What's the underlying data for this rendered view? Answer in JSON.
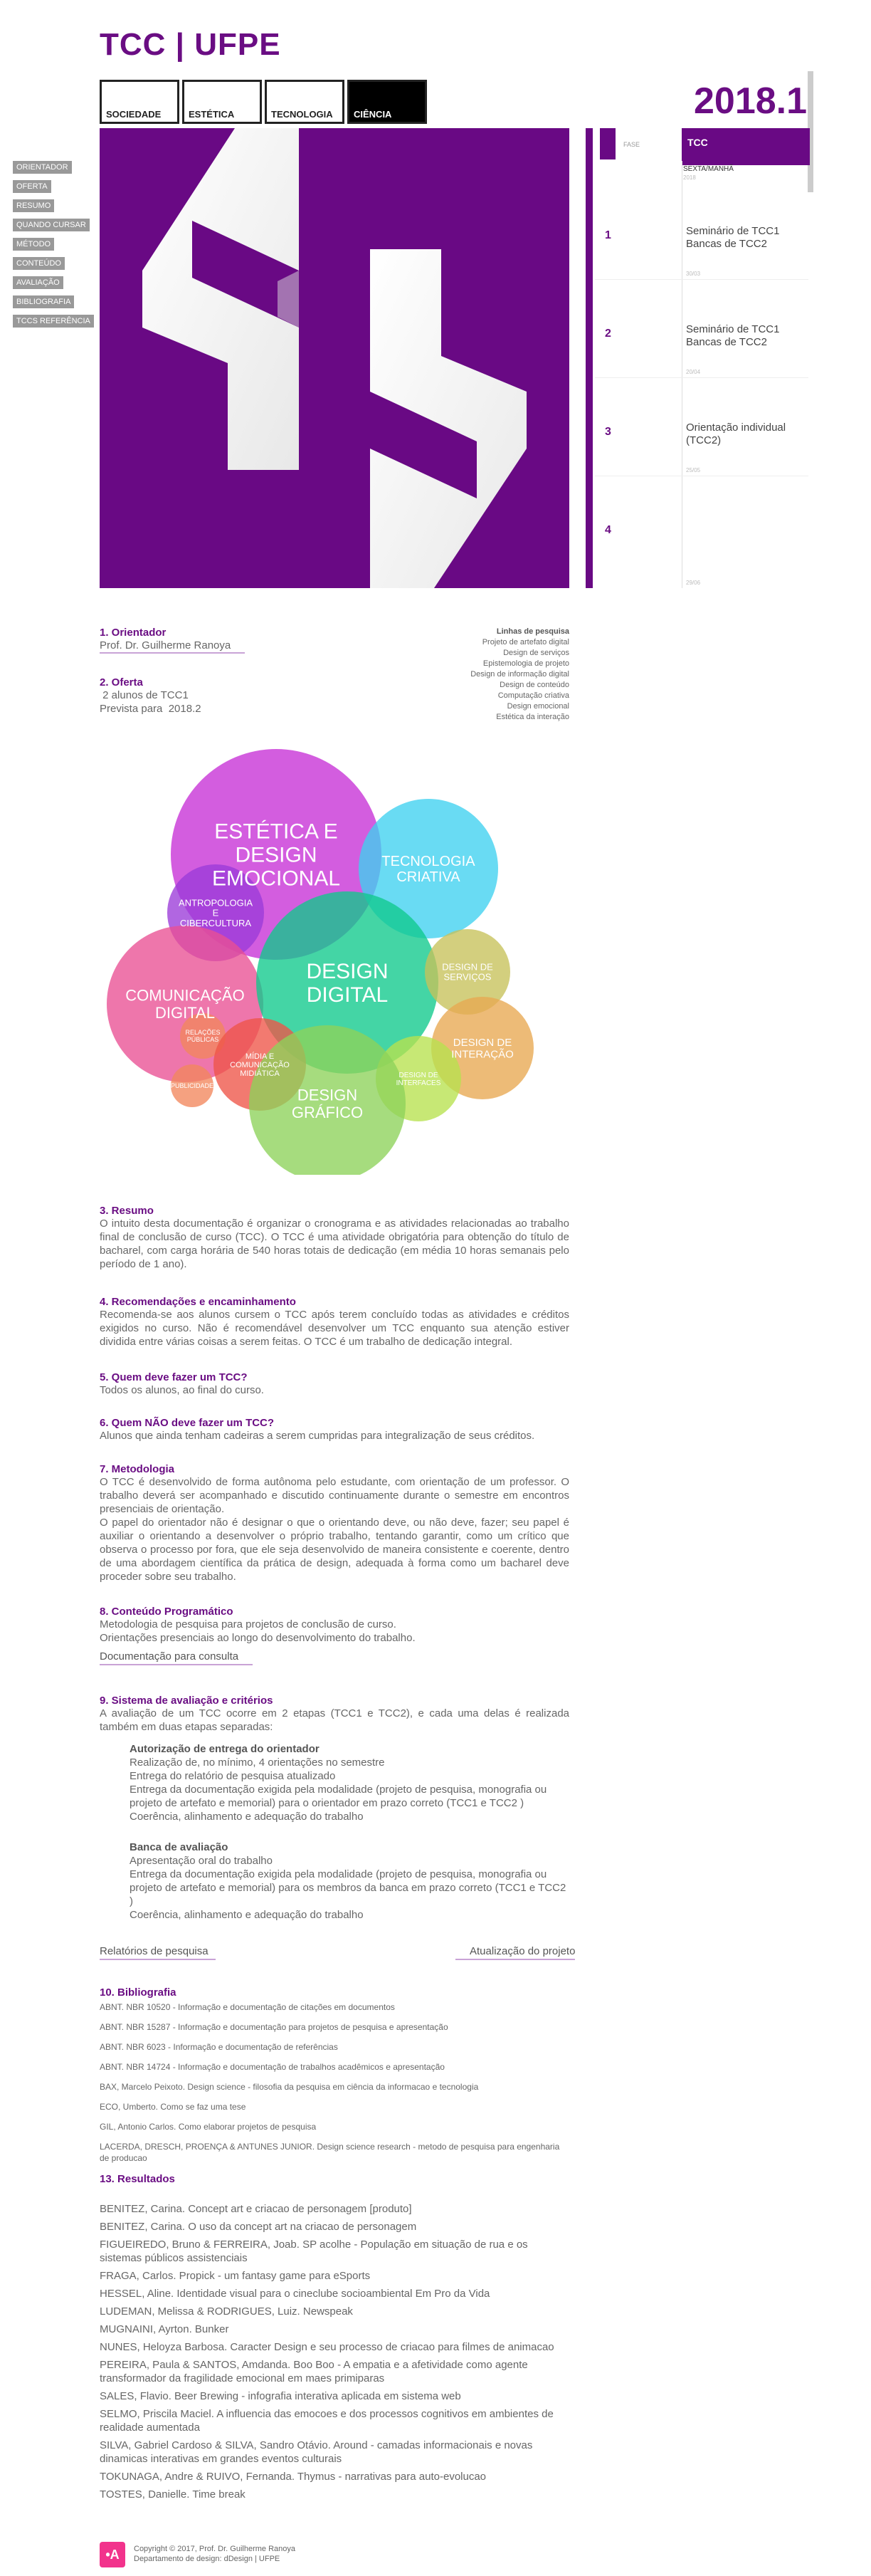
{
  "header": {
    "title": "TCC | UFPE",
    "semester": "2018.1"
  },
  "tabs": [
    {
      "label": "Sociedade"
    },
    {
      "label": "Estética"
    },
    {
      "label": "Tecnologia"
    },
    {
      "label": "Ciência"
    }
  ],
  "side_menu": [
    "ORIENTADOR",
    "OFERTA",
    "RESUMO",
    "QUANDO CURSAR",
    "MÉTODO",
    "CONTEÚDO",
    "AVALIAÇÃO",
    "BIBLIOGRAFIA",
    "TCCS REFERÊNCIA"
  ],
  "timeline": {
    "fase_label": "FASE",
    "tcc_label": "TCC",
    "turno": "SEXTA/MANHÃ",
    "head_date": "2018",
    "rows": [
      {
        "num": "1",
        "text": "Seminário de TCC1\nBancas de TCC2",
        "date": "30/03"
      },
      {
        "num": "2",
        "text": "Seminário de TCC1\nBancas de TCC2",
        "date": "20/04"
      },
      {
        "num": "3",
        "text": "Orientação individual (TCC2)",
        "date": "25/05"
      },
      {
        "num": "4",
        "text": "",
        "date": "29/06"
      }
    ]
  },
  "orientador": {
    "heading": "1. Orientador",
    "name": "Prof. Dr. Guilherme Ranoya"
  },
  "oferta": {
    "heading": "2. Oferta",
    "line1": " 2 alunos de TCC1",
    "line2": "Prevista para  2018.2"
  },
  "linhas": {
    "heading": "Linhas de pesquisa",
    "items": [
      "Projeto de artefato digital",
      "Design de serviços",
      "Epistemologia de projeto",
      "Design de informação digital",
      "Design de conteúdo",
      "Computação criativa",
      "Design emocional",
      "Estética da interação"
    ]
  },
  "bubbles": [
    {
      "label": "ESTÉTICA E\nDESIGN\nEMOCIONAL",
      "color": "#c62fd6"
    },
    {
      "label": "TECNOLOGIA\nCRIATIVA",
      "color": "#3fd1ef"
    },
    {
      "label": "ANTROPOLOGIA\nE\nCIBERCULTURA",
      "color": "#9b3bd8"
    },
    {
      "label": "COMUNICAÇÃO\nDIGITAL",
      "color": "#e94f93"
    },
    {
      "label": "DESIGN\nDIGITAL",
      "color": "#10c98c"
    },
    {
      "label": "DESIGN DE\nSERVIÇOS",
      "color": "#c7c25a"
    },
    {
      "label": "DESIGN DE\nINTERAÇÃO",
      "color": "#e8a851"
    },
    {
      "label": "RELAÇÕES\nPÚBLICAS",
      "color": "#f2865c"
    },
    {
      "label": "MÍDIA E\nCOMUNICAÇÃO\nMIDIÁTICA",
      "color": "#ee5548"
    },
    {
      "label": "PUBLICIDADE",
      "color": "#f2865c"
    },
    {
      "label": "DESIGN DE\nINTERFACES",
      "color": "#b7e24e"
    },
    {
      "label": "DESIGN\nGRÁFICO",
      "color": "#8dd25a"
    }
  ],
  "resumo": {
    "heading": "3. Resumo",
    "text": "O intuito desta documentação é organizar o cronograma e as atividades relacionadas ao trabalho final de conclusão de curso (TCC). O TCC é uma atividade obrigatória para obtenção do título de bacharel, com carga horária de 540 horas totais de dedicação (em média 10 horas semanais pelo período de 1 ano)."
  },
  "recomendacoes": {
    "heading": "4. Recomendações e encaminhamento",
    "text": "Recomenda-se aos alunos cursem o TCC após terem concluído todas as atividades e créditos exigidos no curso. Não é recomendável desenvolver um TCC enquanto sua atenção estiver dividida entre várias coisas a serem feitas. O TCC é um trabalho de dedicação integral."
  },
  "quem": {
    "heading": "5. Quem deve fazer um TCC?",
    "text": "Todos os alunos, ao final do curso."
  },
  "quem_nao": {
    "heading": "6. Quem NÃO deve fazer um TCC?",
    "text": "Alunos que ainda tenham cadeiras a serem cumpridas para integralização de seus créditos."
  },
  "metodologia": {
    "heading": "7. Metodologia",
    "p1": "O TCC é desenvolvido de forma autônoma pelo estudante, com orientação de um professor. O trabalho deverá ser acompanhado e discutido continuamente durante o semestre em encontros presenciais de orientação.",
    "p2": "O papel do orientador não é designar o que o orientando deve, ou não deve, fazer; seu papel é auxiliar o orientando a desenvolver o próprio trabalho, tentando garantir, como um crítico que observa o processo por fora, que ele seja desenvolvido de maneira consistente e coerente, dentro de uma abordagem científica da prática de design, adequada à forma como um bacharel deve proceder sobre seu trabalho."
  },
  "conteudo": {
    "heading": "8. Conteúdo Programático",
    "l1": "Metodologia de pesquisa para projetos de conclusão de curso.",
    "l2": "Orientações presenciais ao longo do desenvolvimento do trabalho.",
    "link": "Documentação para consulta"
  },
  "avaliacao": {
    "heading": "9. Sistema de avaliação e critérios",
    "text": "A avaliação de um TCC ocorre em 2 etapas (TCC1 e TCC2), e cada uma delas é realizada também em duas etapas separadas:",
    "a_title": "Autorização de entrega do orientador",
    "a_items": [
      "Realização de, no mínimo, 4 orientações no semestre",
      "Entrega do relatório de pesquisa atualizado",
      "Entrega da documentação exigida pela modalidade (projeto de pesquisa, monografia ou projeto de artefato e memorial) para o orientador em prazo correto (TCC1  e TCC2 )",
      "Coerência, alinhamento e adequação do trabalho"
    ],
    "b_title": "Banca de avaliação",
    "b_items": [
      "Apresentação oral do trabalho",
      "Entrega da documentação exigida pela modalidade (projeto de pesquisa, monografia ou projeto de artefato e memorial) para os membros da banca em prazo correto (TCC1  e TCC2 )",
      "Coerência, alinhamento e adequação do trabalho"
    ],
    "link_left": "Relatórios de pesquisa",
    "link_right": "Atualização do projeto"
  },
  "bibliografia": {
    "heading": "10. Bibliografia",
    "items": [
      "ABNT. NBR 10520 - Informação e documentação de citações em documentos",
      "ABNT. NBR 15287 - Informação e documentação para projetos de pesquisa e apresentação",
      "ABNT. NBR 6023 - Informação e documentação de referências",
      "ABNT. NBR 14724 - Informação e documentação de trabalhos acadêmicos e apresentação",
      "BAX, Marcelo Peixoto. Design science - filosofia da pesquisa em ciência da informacao e tecnologia",
      "ECO, Umberto. Como se faz uma tese",
      "GIL, Antonio Carlos. Como elaborar projetos de pesquisa",
      "LACERDA, DRESCH, PROENÇA & ANTUNES JUNIOR. Design science research - metodo de pesquisa para engenharia de producao"
    ]
  },
  "resultados": {
    "heading": "13. Resultados",
    "items": [
      "BENITEZ, Carina. Concept art e criacao de personagem [produto]",
      "BENITEZ, Carina. O uso da concept art na criacao de personagem",
      "FIGUEIREDO, Bruno & FERREIRA, Joab. SP acolhe - População em situação de rua e os sistemas públicos assistenciais",
      "FRAGA, Carlos. Propick - um fantasy game para eSports",
      "HESSEL, Aline. Identidade visual para o cineclube socioambiental Em Pro da Vida",
      "LUDEMAN, Melissa & RODRIGUES, Luiz. Newspeak",
      "MUGNAINI, Ayrton. Bunker",
      "NUNES, Heloyza Barbosa. Caracter Design e seu processo de criacao para filmes de animacao",
      "PEREIRA, Paula & SANTOS, Amdanda. Boo Boo - A empatia e a afetividade como agente transformador da fragilidade emocional em maes primiparas",
      "SALES, Flavio. Beer Brewing - infografia interativa aplicada em sistema web",
      "SELMO, Priscila Maciel. A influencia das emocoes e dos processos cognitivos em ambientes de realidade aumentada",
      "SILVA, Gabriel Cardoso & SILVA, Sandro Otávio. Around - camadas informacionais e novas dinamicas interativas em grandes eventos culturais",
      "TOKUNAGA, Andre & RUIVO, Fernanda. Thymus - narrativas para auto-evolucao",
      "TOSTES, Danielle. Time break"
    ]
  },
  "footer": {
    "line1": "Copyright © 2017, Prof. Dr. Guilherme Ranoya",
    "line2": "Departamento de design: dDesign | UFPE"
  },
  "colors": {
    "brand": "#6a0d83",
    "accent_link": "#c9a3d6"
  }
}
